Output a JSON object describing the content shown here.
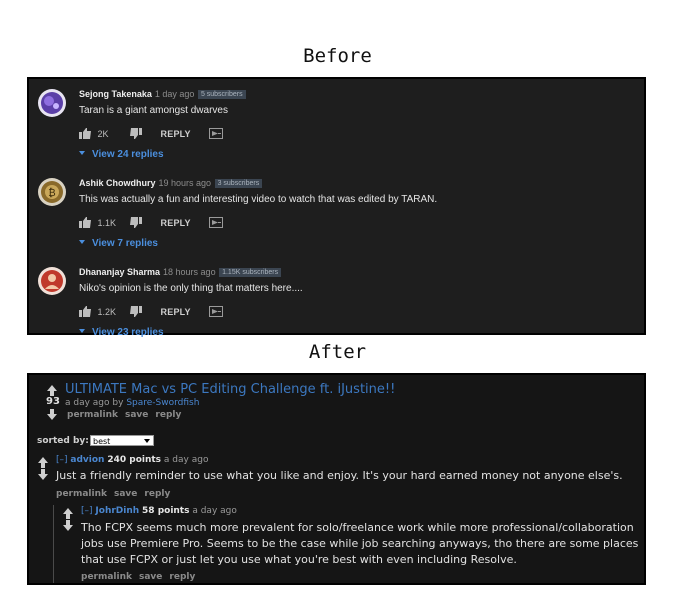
{
  "captions": {
    "before": "Before",
    "after": "After"
  },
  "youtube": {
    "comments": [
      {
        "author": "Sejong Takenaka",
        "time": "1 day ago",
        "badge": "5 subscribers",
        "text": "Taran is a giant amongst dwarves",
        "likes": "2K",
        "reply": "REPLY",
        "replies": "View 24 replies",
        "avatar_color": "#5b3fa8"
      },
      {
        "author": "Ashik Chowdhury",
        "time": "19 hours ago",
        "badge": "3 subscribers",
        "text": "This was actually a fun and interesting video to watch that was edited by TARAN.",
        "likes": "1.1K",
        "reply": "REPLY",
        "replies": "View 7 replies",
        "avatar_color": "#8a6a2a"
      },
      {
        "author": "Dhananjay Sharma",
        "time": "18 hours ago",
        "badge": "1.15K subscribers",
        "text": "Niko's opinion is the only thing that matters here....",
        "likes": "1.2K",
        "reply": "REPLY",
        "replies": "View 23 replies",
        "avatar_color": "#c0392b"
      }
    ]
  },
  "reddit": {
    "post": {
      "score": "93",
      "title": "ULTIMATE Mac vs PC Editing Challenge ft. iJustine!!",
      "submitted_prefix": "a day ago by",
      "author": "Spare-Swordfish",
      "actions": [
        "permalink",
        "save",
        "reply"
      ]
    },
    "sort": {
      "label": "sorted by:",
      "value": "best"
    },
    "comments": [
      {
        "collapse": "[–]",
        "author": "advion",
        "points": "240 points",
        "time": "a day ago",
        "lines": [
          "Just a friendly reminder to use what you like and enjoy. It's your hard earned money not anyone else's."
        ],
        "actions": [
          "permalink",
          "save",
          "reply"
        ]
      },
      {
        "collapse": "[–]",
        "author": "JohrDinh",
        "points": "58 points",
        "time": "a day ago",
        "lines": [
          "Tho FCPX seems much more prevalent for solo/freelance work while more professional/collaboration",
          "jobs use Premiere Pro. Seems to be the case while job searching anyways, tho there are some places",
          "that use FCPX or just let you use what you're best with even including Resolve."
        ],
        "actions": [
          "permalink",
          "save",
          "reply"
        ]
      }
    ]
  }
}
